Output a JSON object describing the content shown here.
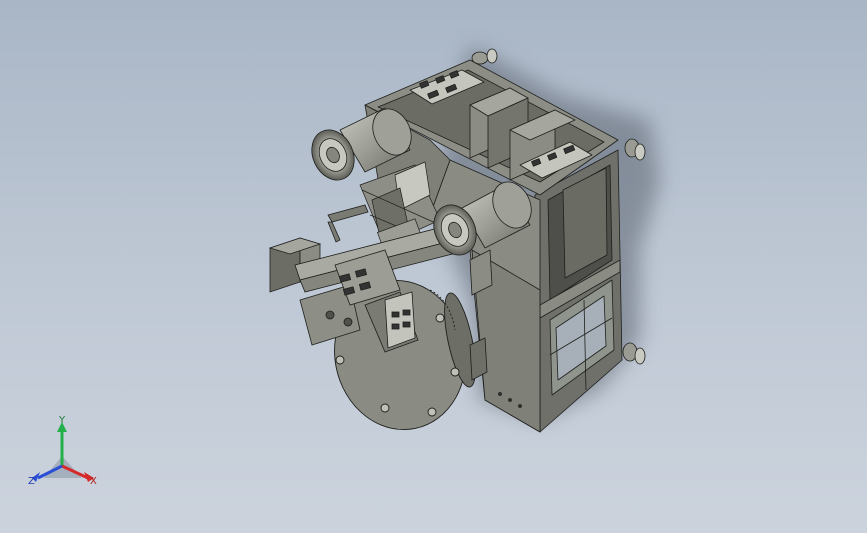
{
  "viewport": {
    "background_top": "#a9b6c6",
    "background_bottom": "#ccd3dd"
  },
  "model": {
    "body_color": "#7c7d74",
    "edge_color": "#1e1f1c",
    "shadow_color": "#5b6470"
  },
  "triad": {
    "x_label": "X",
    "y_label": "Y",
    "z_label": "Z",
    "x_color": "#d42a2a",
    "y_color": "#22b04a",
    "z_color": "#2a4ed4"
  }
}
